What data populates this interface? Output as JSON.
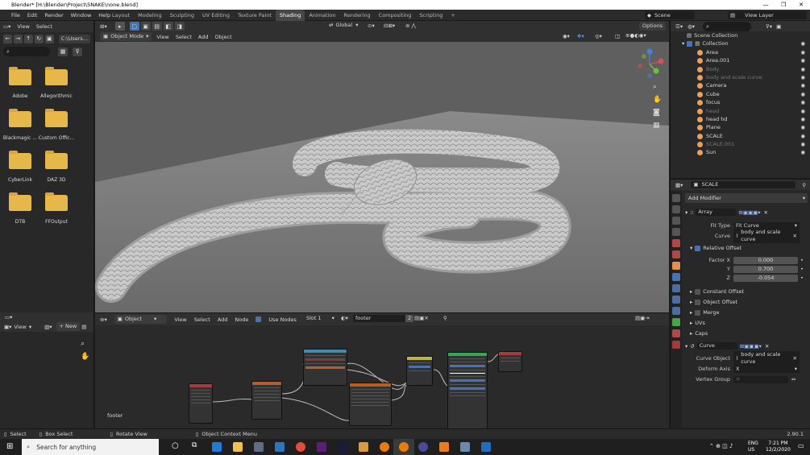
{
  "titlebar": {
    "title": "Blender* [H:\\Blender\\Project\\SNAKE\\none.blend]",
    "min": "—",
    "max": "❐",
    "close": "✕"
  },
  "menubar": {
    "menus": [
      "File",
      "Edit",
      "Render",
      "Window",
      "Help"
    ],
    "tabs": [
      "Layout",
      "Modeling",
      "Sculpting",
      "UV Editing",
      "Texture Paint",
      "Shading",
      "Animation",
      "Rendering",
      "Compositing",
      "Scripting"
    ],
    "active_tab": "Shading",
    "add_tab": "+",
    "scene_label": "Scene",
    "view_layer_label": "View Layer"
  },
  "filebrowser": {
    "menus": [
      "View",
      "Select"
    ],
    "path": "C:\\Users...",
    "folders": [
      "Adobe",
      "Allegorithmic",
      "Blackmagic ...",
      "Custom Offic...",
      "CyberLink",
      "DAZ 3D",
      "DTB",
      "FFOutput"
    ]
  },
  "viewport": {
    "mode": "Object Mode",
    "menus": [
      "View",
      "Select",
      "Add",
      "Object"
    ],
    "orientation": "Global",
    "options": "Options"
  },
  "node_editor": {
    "editor_type": "Object",
    "menus": [
      "View",
      "Select",
      "Add",
      "Node"
    ],
    "use_nodes": "Use Nodes",
    "slot": "Slot 1",
    "material": "footer",
    "users": "2",
    "frame_label": "footer",
    "side_view": "View",
    "side_new": "New"
  },
  "outliner": {
    "root": "Scene Collection",
    "collection": "Collection",
    "items": [
      {
        "name": "Area",
        "color": "#e8a05a",
        "dim": false
      },
      {
        "name": "Area.001",
        "color": "#e8a05a",
        "dim": false
      },
      {
        "name": "Body",
        "color": "#e8a05a",
        "dim": true
      },
      {
        "name": "body and scale curve",
        "color": "#e8a05a",
        "dim": true
      },
      {
        "name": "Camera",
        "color": "#e8a05a",
        "dim": false
      },
      {
        "name": "Cube",
        "color": "#e8a05a",
        "dim": false
      },
      {
        "name": "focus",
        "color": "#e8a05a",
        "dim": false
      },
      {
        "name": "head",
        "color": "#e8a05a",
        "dim": true
      },
      {
        "name": "head hd",
        "color": "#e8a05a",
        "dim": false
      },
      {
        "name": "Plane",
        "color": "#e8a05a",
        "dim": false
      },
      {
        "name": "SCALE",
        "color": "#e8a05a",
        "dim": false
      },
      {
        "name": "SCALE.001",
        "color": "#e8a05a",
        "dim": true
      },
      {
        "name": "Sun",
        "color": "#e8a05a",
        "dim": false
      }
    ]
  },
  "properties": {
    "object_name": "SCALE",
    "add_modifier": "Add Modifier",
    "array": {
      "name": "Array",
      "fit_type_label": "Fit Type",
      "fit_type": "Fit Curve",
      "curve_label": "Curve",
      "curve": "body and scale curve",
      "relative_offset": "Relative Offset",
      "factor_x_label": "Factor X",
      "y_label": "Y",
      "z_label": "Z",
      "factor_x": "0.000",
      "y": "0.700",
      "z": "-0.054",
      "constant_offset": "Constant Offset",
      "object_offset": "Object Offset",
      "merge": "Merge",
      "uvs": "UVs",
      "caps": "Caps"
    },
    "curve_mod": {
      "name": "Curve",
      "curve_object_label": "Curve Object",
      "curve_object": "body and scale curve",
      "deform_axis_label": "Deform Axis",
      "deform_axis": "X",
      "vertex_group_label": "Vertex Group"
    }
  },
  "statusbar": {
    "select": "Select",
    "box_select": "Box Select",
    "rotate_view": "Rotate View",
    "context_menu": "Object Context Menu",
    "version": "2.90.1"
  },
  "taskbar": {
    "search": "Search for anything",
    "lang1": "ENG",
    "lang2": "US",
    "time": "7:21 PM",
    "date": "12/2/2020"
  },
  "colors": {
    "accent": "#4772b3",
    "folder": "#e6b84a",
    "active_tab": "#474747"
  }
}
